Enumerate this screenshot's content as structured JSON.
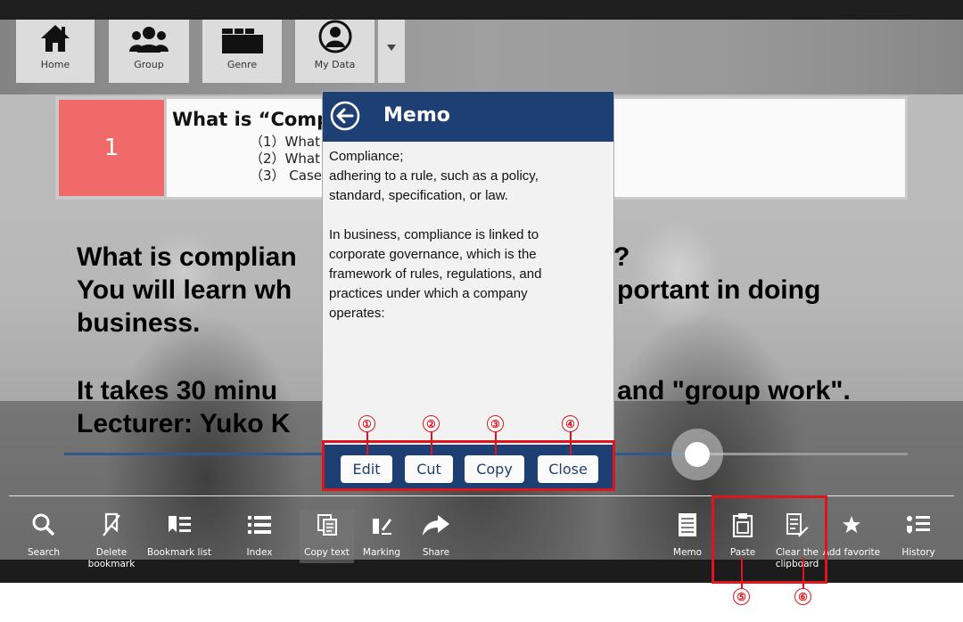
{
  "nav": {
    "home": "Home",
    "group": "Group",
    "genre": "Genre",
    "mydata": "My Data"
  },
  "lesson": {
    "number": "1",
    "title": "What is “Comp",
    "lines": [
      "（1）What",
      "（2）What",
      "（3） Case"
    ]
  },
  "main_text": {
    "line1": "What is complian",
    "line1_tail": "?",
    "line2": "You will learn wh",
    "line2_tail": "portant in doing",
    "line3": "business.",
    "line4": "It takes 30 minu",
    "line4_tail": "and \"group work\".",
    "line5": "Lecturer: Yuko K"
  },
  "player": {
    "progress": 0.75
  },
  "memo": {
    "title": "Memo",
    "paragraph1": "Compliance;\nadhering to a rule, such as a policy,\nstandard, specification, or law.",
    "paragraph2": "In business, compliance is linked to\ncorporate governance, which is the\nframework of rules, regulations, and\npractices under which a company\noperates:",
    "buttons": {
      "edit": "Edit",
      "cut": "Cut",
      "copy": "Copy",
      "close": "Close"
    }
  },
  "toolbar": {
    "search": "Search",
    "delete_bookmark": "Delete\nbookmark",
    "bookmark_list": "Bookmark list",
    "index": "Index",
    "copy_text": "Copy text",
    "marking": "Marking",
    "share": "Share",
    "memo": "Memo",
    "paste": "Paste",
    "clear_clipboard": "Clear the\nclipboard",
    "add_favorite": "Add favorite",
    "history": "History"
  },
  "annotations": {
    "n1": "①",
    "n2": "②",
    "n3": "③",
    "n4": "④",
    "n5": "⑤",
    "n6": "⑥"
  },
  "colors": {
    "accent": "#1e3f73",
    "lesson_badge": "#f06a6a",
    "annotation": "#e0141d"
  }
}
